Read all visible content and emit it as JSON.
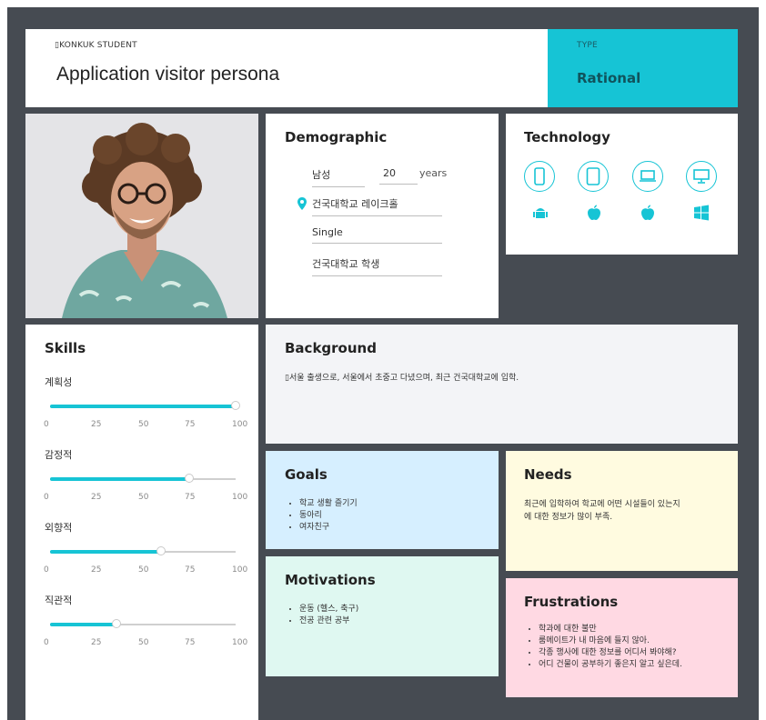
{
  "header": {
    "eyebrow": "▯KONKUK STUDENT",
    "title": "Application visitor persona"
  },
  "type_panel": {
    "label": "TYPE",
    "value": "Rational"
  },
  "demographic": {
    "title": "Demographic",
    "gender": "남성",
    "age": "20",
    "age_unit": "years",
    "location": "건국대학교 레이크홀",
    "status": "Single",
    "occupation": "건국대학교 학생"
  },
  "technology": {
    "title": "Technology",
    "devices": [
      "mobile-icon",
      "tablet-icon",
      "laptop-icon",
      "desktop-icon"
    ],
    "platforms": [
      "android-icon",
      "apple-icon",
      "apple-icon",
      "windows-icon"
    ]
  },
  "skills": {
    "title": "Skills",
    "ticks": [
      "0",
      "25",
      "50",
      "75",
      "100"
    ],
    "items": [
      {
        "label": "계획성",
        "value": 100
      },
      {
        "label": "감정적",
        "value": 75
      },
      {
        "label": "외향적",
        "value": 60
      },
      {
        "label": "직관적",
        "value": 36
      }
    ]
  },
  "background": {
    "title": "Background",
    "text": "▯서울 출생으로, 서울에서 초중고 다녔으며, 최근 건국대학교에 입학."
  },
  "goals": {
    "title": "Goals",
    "items": [
      "학교 생활 즐기기",
      "동아리",
      "여자친구"
    ]
  },
  "needs": {
    "title": "Needs",
    "text_line1": "최근에 입학하여 학교에 어떤 시설들이 있는지",
    "text_line2": "에 대한 정보가 많이 부족."
  },
  "motivations": {
    "title": "Motivations",
    "items": [
      "운동 (헬스, 축구)",
      "전공 관련 공부"
    ]
  },
  "frustrations": {
    "title": "Frustrations",
    "items": [
      "학과에 대한 불만",
      "룸메이트가 내 마음에 들지 않아.",
      "각종 행사에 대한 정보를 어디서 봐야해?",
      "어디 건물이 공부하기 좋은지 알고 싶은데."
    ]
  },
  "colors": {
    "accent": "#16c4d5",
    "frame": "#464b52",
    "goals_bg": "#d6efff",
    "needs_bg": "#fffbe0",
    "motivations_bg": "#dff8f1",
    "frustrations_bg": "#ffd9e3"
  }
}
